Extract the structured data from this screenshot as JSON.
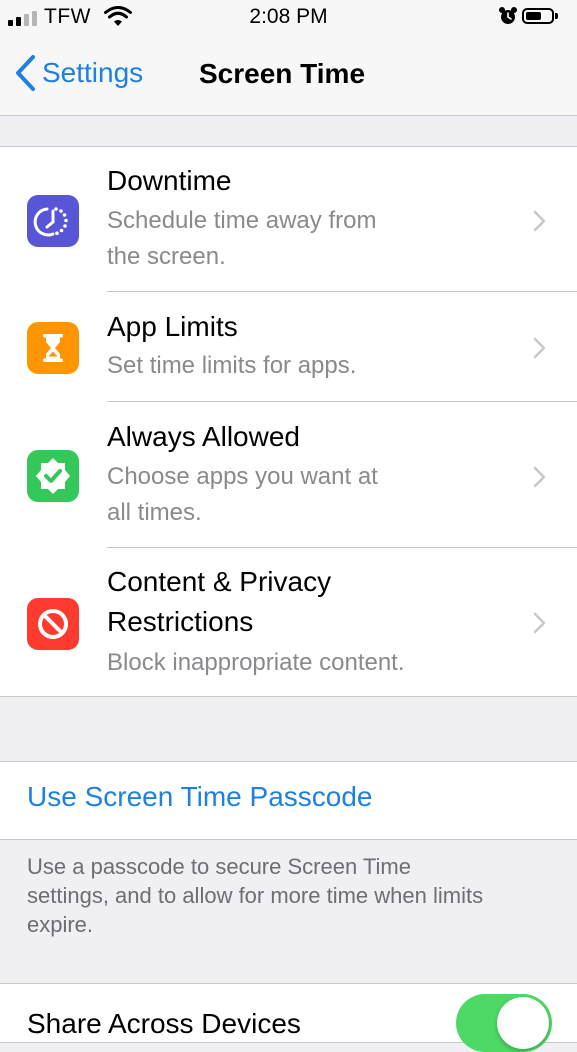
{
  "status_bar": {
    "carrier": "TFW",
    "time": "2:08 PM"
  },
  "nav": {
    "back_label": "Settings",
    "title": "Screen Time"
  },
  "features": [
    {
      "title": "Downtime",
      "subtitle_lines": [
        "Schedule time away from",
        "the screen."
      ],
      "icon": "downtime-icon",
      "color": "#5856D6"
    },
    {
      "title": "App Limits",
      "subtitle_lines": [
        "Set time limits for apps."
      ],
      "icon": "hourglass-icon",
      "color": "#FF9500"
    },
    {
      "title": "Always Allowed",
      "subtitle_lines": [
        "Choose apps you want at",
        "all times."
      ],
      "icon": "checkmark-badge-icon",
      "color": "#34C759"
    },
    {
      "title_lines": [
        "Content & Privacy",
        "Restrictions"
      ],
      "subtitle_lines": [
        "Block inappropriate content."
      ],
      "icon": "prohibited-icon",
      "color": "#FF3B30"
    }
  ],
  "passcode": {
    "label": "Use Screen Time Passcode",
    "footer_lines": [
      "Use a passcode to secure Screen Time",
      "settings, and to allow for more time when limits",
      "expire."
    ]
  },
  "share": {
    "label": "Share Across Devices",
    "enabled": true
  },
  "colors": {
    "accent": "#1E80E0",
    "toggle_on": "#4CD964",
    "background": "#EFEFF4"
  }
}
